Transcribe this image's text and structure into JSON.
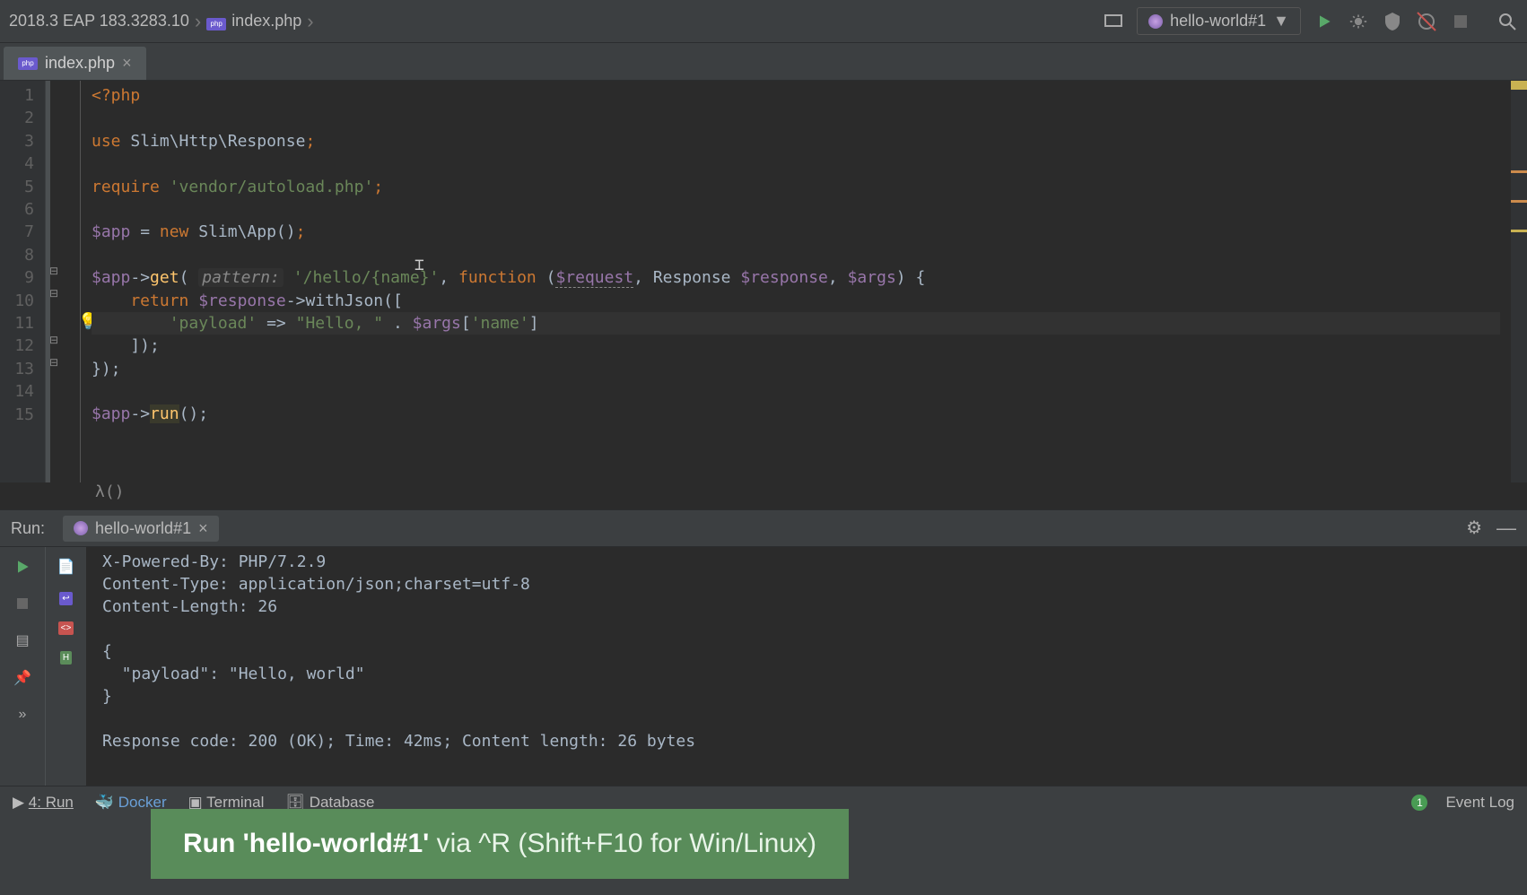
{
  "app_title": "2018.3 EAP 183.3283.10",
  "breadcrumb_file": "index.php",
  "tab": {
    "label": "index.php"
  },
  "run_config": {
    "label": "hello-world#1"
  },
  "editor": {
    "line_numbers": [
      "1",
      "2",
      "3",
      "4",
      "5",
      "6",
      "7",
      "8",
      "9",
      "10",
      "11",
      "12",
      "13",
      "14",
      "15"
    ],
    "crumb_path": "λ()",
    "code": {
      "l1_open": "<?php",
      "l3_use": "use ",
      "l3_ns": "Slim\\Http\\Response",
      "l3_sc": ";",
      "l5_req": "require ",
      "l5_str": "'vendor/autoload.php'",
      "l5_sc": ";",
      "l7_var": "$app",
      "l7_eq": " = ",
      "l7_new": "new ",
      "l7_cls": "Slim\\App()",
      "l7_sc": ";",
      "l9_var": "$app",
      "l9_arr": "->",
      "l9_get": "get",
      "l9_open": "( ",
      "l9_hint": "pattern:",
      "l9_space": " ",
      "l9_str": "'/hello/{name}'",
      "l9_comma": ", ",
      "l9_func": "function",
      "l9_sig1": " (",
      "l9_req": "$request",
      "l9_sig2": ", Response ",
      "l9_resp": "$response",
      "l9_sig3": ", ",
      "l9_args": "$args",
      "l9_sig4": ") {",
      "l10_ret": "    return ",
      "l10_var": "$response",
      "l10_call": "->withJson([",
      "l11_pad": "        ",
      "l11_key": "'payload'",
      "l11_arrow": " => ",
      "l11_str": "\"Hello, \"",
      "l11_concat": " . ",
      "l11_args": "$args",
      "l11_idx1": "[",
      "l11_idx2": "'name'",
      "l11_idx3": "]",
      "l12": "    ]);",
      "l13": "});",
      "l15_var": "$app",
      "l15_arr": "->",
      "l15_run": "run",
      "l15_sc": "();"
    }
  },
  "run_panel": {
    "title": "Run:",
    "tab": "hello-world#1",
    "output": "X-Powered-By: PHP/7.2.9\nContent-Type: application/json;charset=utf-8\nContent-Length: 26\n\n{\n  \"payload\": \"Hello, world\"\n}\n\nResponse code: 200 (OK); Time: 42ms; Content length: 26 bytes"
  },
  "statusbar": {
    "run": "4: Run",
    "docker": "Docker",
    "terminal": "Terminal",
    "database": "Database",
    "event_badge": "1",
    "event_log": "Event Log"
  },
  "popup": {
    "bold": "Run 'hello-world#1'",
    "rest": " via ^R (Shift+F10 for Win/Linux)"
  }
}
